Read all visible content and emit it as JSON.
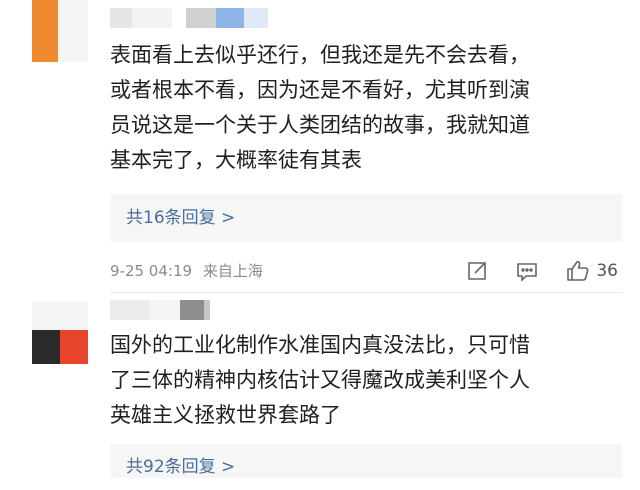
{
  "comments": [
    {
      "avatar_colors": [
        "#f08a2e",
        "#f4f4f4"
      ],
      "name_blur_colors": [
        "#d3d3d3",
        "#e4e4e4",
        "#8fb4e8",
        "#dfe9f7"
      ],
      "text_lines": [
        "表面看上去似乎还行，但我还是先不会去看，",
        "或者根本不看，因为还是不看好，尤其听到演",
        "员说这是一个关于人类团结的故事，我就知道",
        "基本完了，大概率徒有其表"
      ],
      "reply_label": "共16条回复 >",
      "timestamp": "9-25 04:19",
      "location": "来自上海",
      "like_count": "36",
      "icons": [
        "share-icon",
        "comment-icon",
        "like-icon"
      ]
    },
    {
      "avatar_colors": [
        "#2b2b2b",
        "#e8452c"
      ],
      "name_blur_colors": [
        "#dcdcdc",
        "#8e8e8e",
        "#c8c8c8"
      ],
      "text_lines": [
        "国外的工业化制作水准国内真没法比，只可惜",
        "了三体的精神内核估计又得魔改成美利坚个人",
        "英雄主义拯救世界套路了"
      ],
      "reply_label": "共92条回复 >"
    }
  ]
}
